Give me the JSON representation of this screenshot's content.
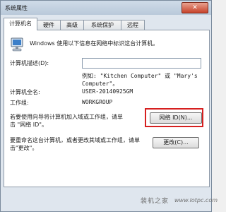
{
  "window": {
    "title": "系统属性",
    "close_glyph": "✕"
  },
  "tabs": [
    {
      "label": "计算机名",
      "active": true
    },
    {
      "label": "硬件",
      "active": false
    },
    {
      "label": "高级",
      "active": false
    },
    {
      "label": "系统保护",
      "active": false
    },
    {
      "label": "远程",
      "active": false
    }
  ],
  "panel": {
    "intro": "Windows 使用以下信息在网络中标识这台计算机。",
    "description_label": "计算机描述(D):",
    "description_value": "",
    "example_line1": "例如: \"Kitchen Computer\" 或 \"Mary's",
    "example_line2": "Computer\"。",
    "fullname_label": "计算机全名:",
    "fullname_value": "USER-20140925GM",
    "workgroup_label": "工作组:",
    "workgroup_value": "WORKGROUP",
    "network_help_line1": "若要使用向导将计算机加入域或工作组，请单",
    "network_help_line2": "击 \"网络 ID\"。",
    "network_id_button": "网络 ID(N)...",
    "rename_help_line1": "要重命名这台计算机，或者更改其域或工作组，请单",
    "rename_help_line2": "击\"更改\"。",
    "change_button": "更改(C)..."
  },
  "watermark": {
    "text": "装机之家",
    "url": "www.lotpc.com"
  },
  "colors": {
    "highlight": "#d62020"
  }
}
